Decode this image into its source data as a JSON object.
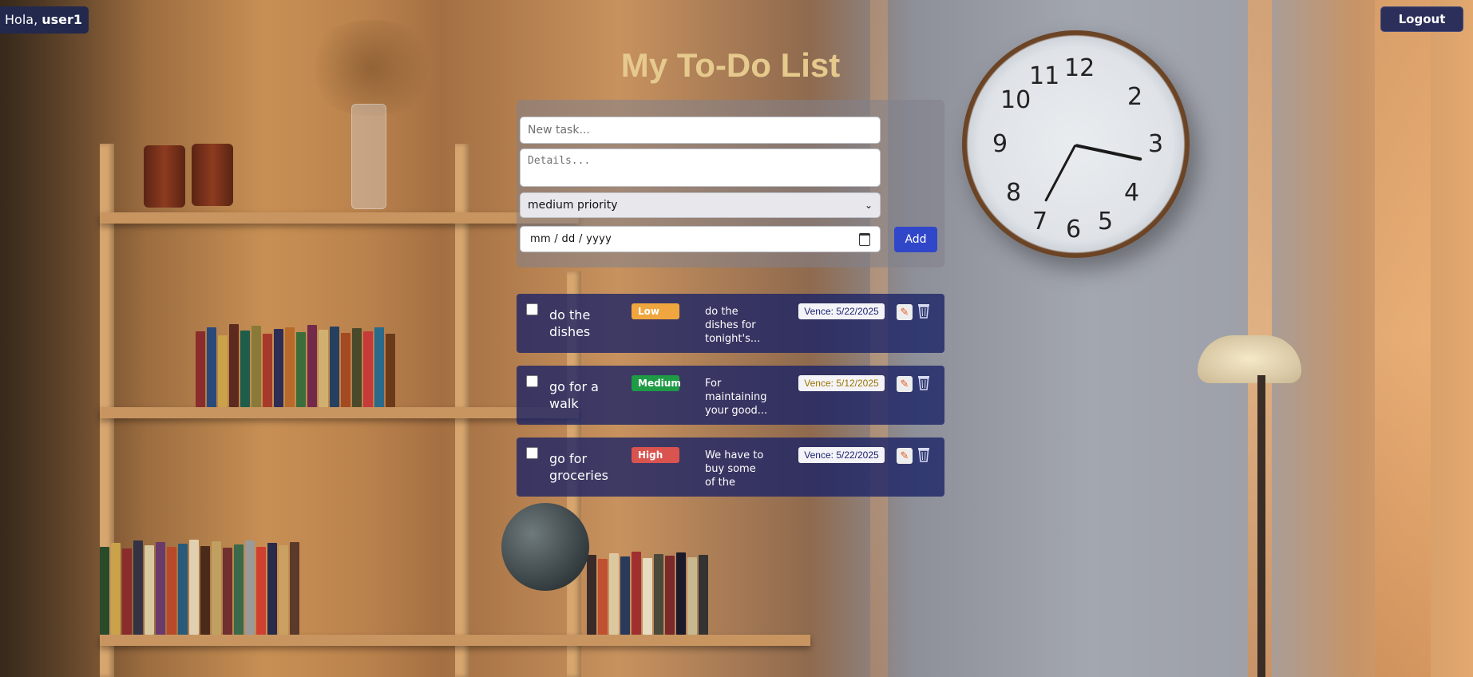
{
  "header": {
    "greeting_prefix": "Hola, ",
    "username": "user1",
    "logout_label": "Logout"
  },
  "title": "My To-Do List",
  "form": {
    "task_placeholder": "New task...",
    "details_placeholder": "Details...",
    "priority_selected": "medium priority",
    "date_placeholder": "mm / dd / yyyy",
    "add_label": "Add"
  },
  "colors": {
    "low": "#f0a63e",
    "medium": "#1f9a45",
    "high": "#d9534f",
    "due_medium_text": "#9a7400",
    "due_text": "#1b2370"
  },
  "tasks": [
    {
      "name": "do the dishes",
      "priority": "Low",
      "description": "do the dishes for tonight's...",
      "due": "Vence: 5/22/2025",
      "edit_icon": "pencil-icon",
      "delete_icon": "trash-icon"
    },
    {
      "name": "go for a walk",
      "priority": "Medium",
      "description": "For maintaining your good...",
      "due": "Vence: 5/12/2025",
      "edit_icon": "pencil-icon",
      "delete_icon": "trash-icon"
    },
    {
      "name": "go for groceries",
      "priority": "High",
      "description": "We have to buy some of the groceri...",
      "due": "Vence: 5/22/2025",
      "edit_icon": "pencil-icon",
      "delete_icon": "trash-icon"
    }
  ]
}
